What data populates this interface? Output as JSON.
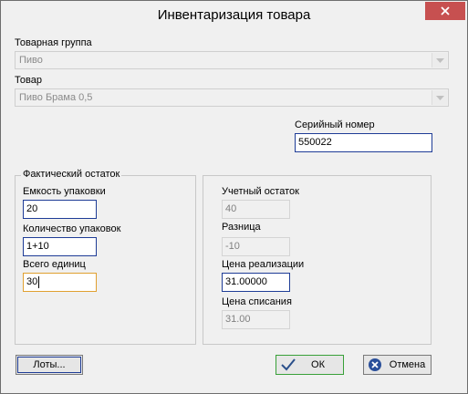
{
  "window": {
    "title": "Инвентаризация товара"
  },
  "product_group": {
    "label": "Товарная группа",
    "value": "Пиво"
  },
  "product": {
    "label": "Товар",
    "value": "Пиво Брама 0,5"
  },
  "serial": {
    "label": "Серийный номер",
    "value": "550022"
  },
  "actual_stock": {
    "caption": "Фактический остаток",
    "pack_capacity_label": "Емкость упаковки",
    "pack_capacity_value": "20",
    "pack_count_label": "Количество упаковок",
    "pack_count_value": "1+10",
    "total_units_label": "Всего единиц",
    "total_units_value": "30"
  },
  "accounting": {
    "book_stock_label": "Учетный остаток",
    "book_stock_value": "40",
    "difference_label": "Разница",
    "difference_value": "-10",
    "sale_price_label": "Цена реализации",
    "sale_price_value": "31.00000",
    "writeoff_price_label": "Цена списания",
    "writeoff_price_value": "31.00"
  },
  "buttons": {
    "lots": "Лоты...",
    "ok": "ОК",
    "cancel": "Отмена"
  },
  "colors": {
    "close": "#c75050",
    "focus_border": "#e0a030",
    "input_border": "#1e3c96",
    "ok_border": "#38a038"
  }
}
